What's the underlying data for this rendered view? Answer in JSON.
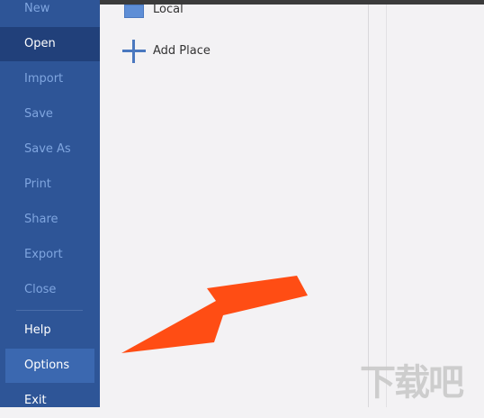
{
  "menu": [
    {
      "label": "New",
      "state": "dim"
    },
    {
      "label": "Open",
      "state": "active"
    },
    {
      "label": "Import",
      "state": "dim"
    },
    {
      "label": "Save",
      "state": "dim"
    },
    {
      "label": "Save As",
      "state": "dim"
    },
    {
      "label": "Print",
      "state": "dim"
    },
    {
      "label": "Share",
      "state": "dim"
    },
    {
      "label": "Export",
      "state": "dim"
    },
    {
      "label": "Close",
      "state": "dim"
    },
    {
      "label": "Help",
      "state": "strong"
    },
    {
      "label": "Options",
      "state": "hover"
    },
    {
      "label": "Exit",
      "state": "strong"
    }
  ],
  "places": {
    "local_label": "Local",
    "add_place_label": "Add Place"
  },
  "colors": {
    "sidebar_bg": "#2e5597",
    "active_bg": "#21407a",
    "hover_bg": "#3b68b0",
    "arrow": "#ff4d14",
    "content_bg": "#f3f2f4"
  },
  "watermark": "下载吧"
}
